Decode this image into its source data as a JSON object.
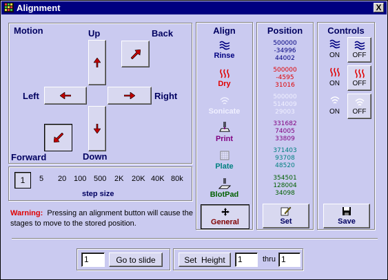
{
  "window": {
    "title": "Alignment",
    "close_label": "X"
  },
  "motion": {
    "title": "Motion",
    "up": "Up",
    "down": "Down",
    "left": "Left",
    "right": "Right",
    "back": "Back",
    "forward": "Forward"
  },
  "step_size": {
    "options": [
      "1",
      "5",
      "20",
      "100",
      "500",
      "2K",
      "20K",
      "40K",
      "80k"
    ],
    "selected": "1",
    "label": "step size"
  },
  "warning": {
    "prefix": "Warning:",
    "text": "Pressing an alignment button will cause the stages to move to the stored position."
  },
  "align": {
    "title": "Align",
    "items": [
      {
        "label": "Rinse",
        "color": "#000080"
      },
      {
        "label": "Dry",
        "color": "#e00000"
      },
      {
        "label": "Sonicate",
        "color": "#f0f0ff"
      },
      {
        "label": "Print",
        "color": "#800080"
      },
      {
        "label": "Plate",
        "color": "#008080"
      },
      {
        "label": "BlotPad",
        "color": "#006000"
      }
    ],
    "general_label": "General"
  },
  "position": {
    "title": "Position",
    "groups": [
      {
        "values": [
          "500000",
          "-34996",
          "44002"
        ],
        "color": "#000080"
      },
      {
        "values": [
          "500000",
          "-4595",
          "31016"
        ],
        "color": "#e00000"
      },
      {
        "values": [
          "500000",
          "514009",
          "29003"
        ],
        "color": "#f0f0ff"
      },
      {
        "values": [
          "331682",
          "74005",
          "33809"
        ],
        "color": "#800080"
      },
      {
        "values": [
          "371403",
          "93708",
          "48520"
        ],
        "color": "#008080"
      },
      {
        "values": [
          "354501",
          "128004",
          "34098"
        ],
        "color": "#006000"
      }
    ],
    "set_label": "Set"
  },
  "controls": {
    "title": "Controls",
    "rinse_on": "ON",
    "rinse_off": "OFF",
    "dry_on": "ON",
    "dry_off": "OFF",
    "sonicate_on": "ON",
    "sonicate_off": "OFF",
    "save_label": "Save"
  },
  "bottom": {
    "slide_value": "1",
    "goto_label": "Go to slide",
    "set_height_label": "Set  Height",
    "height_from": "1",
    "thru_label": "thru",
    "height_to": "1"
  }
}
